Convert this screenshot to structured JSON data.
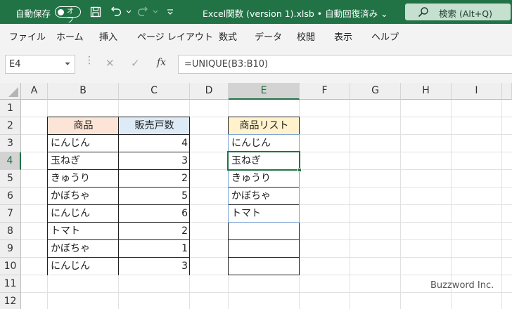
{
  "titlebar": {
    "autosave_label": "自動保存",
    "autosave_state": "オフ",
    "title": "Excel関数 (version 1).xlsb  •  自動回復済み ⌄",
    "search_placeholder": "検索 (Alt+Q)",
    "icons": [
      "save-icon",
      "undo-icon",
      "redo-icon",
      "customize-icon",
      "search-icon"
    ]
  },
  "ribbon": {
    "tabs": [
      "ファイル",
      "ホーム",
      "挿入",
      "ページ レイアウト",
      "数式",
      "データ",
      "校閲",
      "表示",
      "ヘルプ"
    ]
  },
  "formula_bar": {
    "name_box": "E4",
    "formula": "=UNIQUE(B3:B10)",
    "fx_label": "fx",
    "icons": [
      "cancel-icon",
      "enter-icon",
      "function-icon"
    ]
  },
  "sheet": {
    "columns": [
      "A",
      "B",
      "C",
      "D",
      "E",
      "F",
      "G",
      "H",
      "I"
    ],
    "rows": [
      "1",
      "2",
      "3",
      "4",
      "5",
      "6",
      "7",
      "8",
      "9",
      "10",
      "11",
      "12"
    ],
    "selected_cell": "E4",
    "header_colors": {
      "b": "#fce4d6",
      "c": "#ddebf7",
      "e": "#fff2cc",
      "accent": "#217346"
    },
    "table": {
      "headers": [
        "商品",
        "販売戸数"
      ],
      "rows": [
        [
          "にんじん",
          "4"
        ],
        [
          "玉ねぎ",
          "3"
        ],
        [
          "きゅうり",
          "2"
        ],
        [
          "かぼちゃ",
          "5"
        ],
        [
          "にんじん",
          "6"
        ],
        [
          "トマト",
          "2"
        ],
        [
          "かぼちゃ",
          "1"
        ],
        [
          "にんじん",
          "3"
        ]
      ]
    },
    "list": {
      "header": "商品リスト",
      "items": [
        "にんじん",
        "玉ねぎ",
        "きゅうり",
        "かぼちゃ",
        "トマト"
      ]
    }
  },
  "watermark": "Buzzword Inc."
}
